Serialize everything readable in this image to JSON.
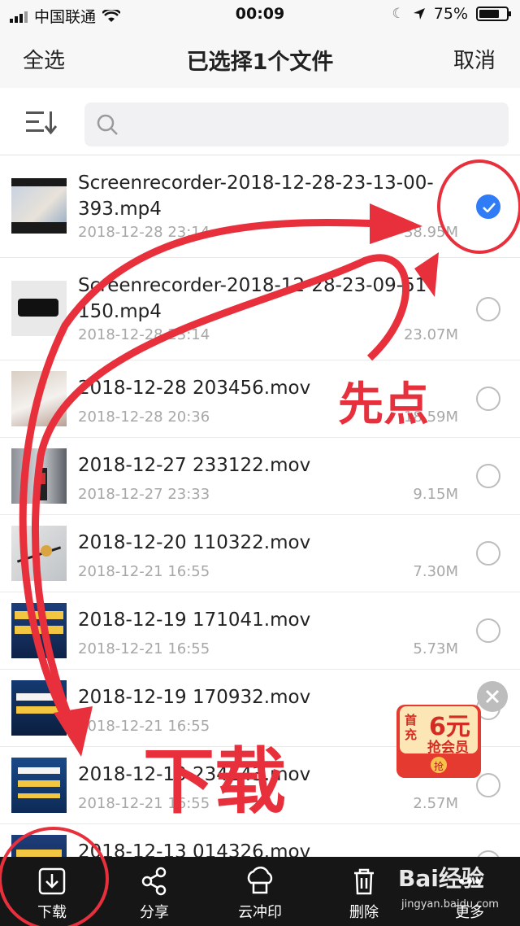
{
  "status": {
    "carrier": "中国联通",
    "time": "00:09",
    "battery": "75%",
    "battery_level": 0.75
  },
  "nav": {
    "left": "全选",
    "title": "已选择1个文件",
    "right": "取消"
  },
  "search": {
    "placeholder": ""
  },
  "files": [
    {
      "name": "Screenrecorder-2018-12-28-23-13-00-393.mp4",
      "date": "2018-12-28 23:14",
      "size": "38.95M",
      "selected": true
    },
    {
      "name": "Screenrecorder-2018-12-28-23-09-51-150.mp4",
      "date": "2018-12-28 23:14",
      "size": "23.07M",
      "selected": false
    },
    {
      "name": "2018-12-28 203456.mov",
      "date": "2018-12-28 20:36",
      "size": "18.59M",
      "selected": false
    },
    {
      "name": "2018-12-27 233122.mov",
      "date": "2018-12-27 23:33",
      "size": "9.15M",
      "selected": false
    },
    {
      "name": "2018-12-20 110322.mov",
      "date": "2018-12-21 16:55",
      "size": "7.30M",
      "selected": false
    },
    {
      "name": "2018-12-19 171041.mov",
      "date": "2018-12-21 16:55",
      "size": "5.73M",
      "selected": false
    },
    {
      "name": "2018-12-19 170932.mov",
      "date": "2018-12-21 16:55",
      "size": "",
      "selected": false
    },
    {
      "name": "2018-12-13 234143.mov",
      "date": "2018-12-21 16:55",
      "size": "2.57M",
      "selected": false
    },
    {
      "name": "2018-12-13 014326.mov",
      "date": "",
      "size": "",
      "selected": false
    }
  ],
  "bottom_tabs": [
    {
      "label": "下载",
      "icon": "download-icon"
    },
    {
      "label": "分享",
      "icon": "share-icon"
    },
    {
      "label": "云冲印",
      "icon": "cloud-print-icon"
    },
    {
      "label": "删除",
      "icon": "trash-icon"
    },
    {
      "label": "更多",
      "icon": "more-icon"
    }
  ],
  "promo": {
    "line1": "首充",
    "amount": "6元",
    "line2": "抢会员",
    "badge": "抢"
  },
  "annotations": {
    "first_click": "先点",
    "download": "下载"
  },
  "watermark": {
    "logo": "Bai经验",
    "url": "jingyan.baidu.com"
  },
  "colors": {
    "accent": "#2f7cf6",
    "annotation": "#e8303c",
    "bottom_bar": "#161616"
  }
}
